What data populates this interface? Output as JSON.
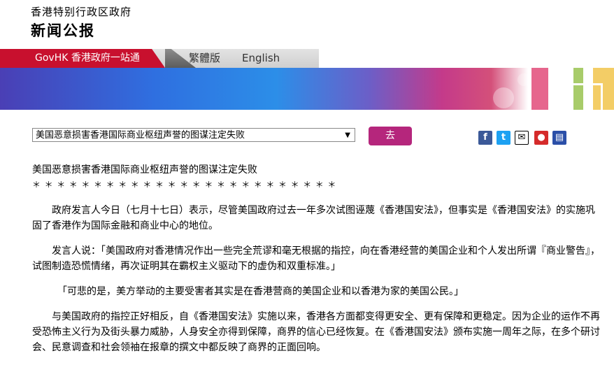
{
  "header": {
    "gov_name": "香港特别行政区政府",
    "site_title": "新闻公报"
  },
  "nav": {
    "govhk": "GovHK 香港政府一站通",
    "traditional": "繁體版",
    "english": "English"
  },
  "toolbar": {
    "topic_selected": "美国恶意损害香港国际商业枢纽声誉的图谋注定失败",
    "go_label": "去",
    "share_icons": [
      "facebook-icon",
      "twitter-icon",
      "email-icon",
      "weibo-icon",
      "print-icon"
    ]
  },
  "article": {
    "headline": "美国恶意损害香港国际商业枢纽声誉的图谋注定失败",
    "stars": "＊＊＊＊＊＊＊＊＊＊＊＊＊＊＊＊＊＊＊＊＊＊＊＊＊",
    "paragraphs": [
      "政府发言人今日（七月十七日）表示，尽管美国政府过去一年多次试图诬蔑《香港国安法》，但事实是《香港国安法》的实施巩固了香港作为国际金融和商业中心的地位。",
      "发言人说：「美国政府对香港情况作出一些完全荒谬和毫无根据的指控，向在香港经营的美国企业和个人发出所谓『商业警告』，试图制造恐慌情绪，再次证明其在霸权主义驱动下的虚伪和双重标准。」",
      "「可悲的是，美方举动的主要受害者其实是在香港营商的美国企业和以香港为家的美国公民。」",
      "与美国政府的指控正好相反，自《香港国安法》实施以来，香港各方面都变得更安全、更有保障和更稳定。因为企业的运作不再受恐怖主义行为及街头暴力威胁，人身安全亦得到保障，商界的信心已经恢复。在《香港国安法》颁布实施一周年之际，在多个研讨会、民意调查和社会领袖在报章的撰文中都反映了商界的正面回响。"
    ]
  },
  "colors": {
    "accent_red": "#c8102e",
    "go_button": "#b5267c",
    "facebook": "#3b5998",
    "twitter": "#1da1f2"
  }
}
